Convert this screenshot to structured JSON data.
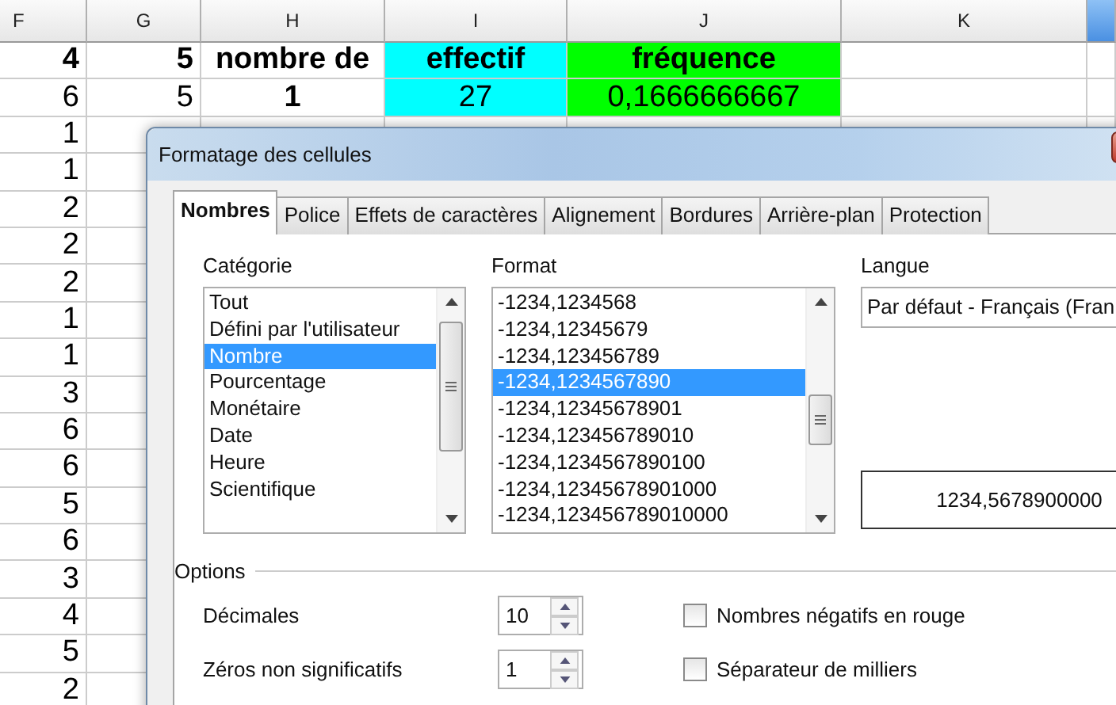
{
  "sheet": {
    "columns": [
      {
        "label": "F"
      },
      {
        "label": "G"
      },
      {
        "label": "H"
      },
      {
        "label": "I"
      },
      {
        "label": "J"
      },
      {
        "label": "K"
      }
    ],
    "rows": [
      {
        "cells": [
          "4",
          "5",
          "nombre de",
          "effectif",
          "fréquence"
        ]
      },
      {
        "cells": [
          "6",
          "5",
          "1",
          "27",
          "0,1666666667"
        ]
      },
      {
        "cells": [
          "1"
        ]
      },
      {
        "cells": [
          "1"
        ]
      },
      {
        "cells": [
          "2"
        ]
      },
      {
        "cells": [
          "2"
        ]
      },
      {
        "cells": [
          "2"
        ]
      },
      {
        "cells": [
          "1"
        ]
      },
      {
        "cells": [
          "1"
        ]
      },
      {
        "cells": [
          "3"
        ]
      },
      {
        "cells": [
          "6"
        ]
      },
      {
        "cells": [
          "6"
        ]
      },
      {
        "cells": [
          "5"
        ]
      },
      {
        "cells": [
          "6"
        ]
      },
      {
        "cells": [
          "3"
        ]
      },
      {
        "cells": [
          "4"
        ]
      },
      {
        "cells": [
          "5"
        ]
      },
      {
        "cells": [
          "2"
        ]
      }
    ]
  },
  "dialog": {
    "title": "Formatage des cellules",
    "tabs": [
      {
        "label": "Nombres",
        "selected": true
      },
      {
        "label": "Police",
        "selected": false
      },
      {
        "label": "Effets de caractères",
        "selected": false
      },
      {
        "label": "Alignement",
        "selected": false
      },
      {
        "label": "Bordures",
        "selected": false
      },
      {
        "label": "Arrière-plan",
        "selected": false
      },
      {
        "label": "Protection",
        "selected": false
      }
    ],
    "category": {
      "label": "Catégorie",
      "items": [
        {
          "label": "Tout",
          "selected": false
        },
        {
          "label": "Défini par l'utilisateur",
          "selected": false
        },
        {
          "label": "Nombre",
          "selected": true
        },
        {
          "label": "Pourcentage",
          "selected": false
        },
        {
          "label": "Monétaire",
          "selected": false
        },
        {
          "label": "Date",
          "selected": false
        },
        {
          "label": "Heure",
          "selected": false
        },
        {
          "label": "Scientifique",
          "selected": false
        }
      ]
    },
    "format": {
      "label": "Format",
      "items": [
        {
          "label": "-1234,1234568",
          "selected": false
        },
        {
          "label": "-1234,12345679",
          "selected": false
        },
        {
          "label": "-1234,123456789",
          "selected": false
        },
        {
          "label": "-1234,1234567890",
          "selected": true
        },
        {
          "label": "-1234,12345678901",
          "selected": false
        },
        {
          "label": "-1234,123456789010",
          "selected": false
        },
        {
          "label": "-1234,1234567890100",
          "selected": false
        },
        {
          "label": "-1234,12345678901000",
          "selected": false
        },
        {
          "label": "-1234,123456789010000",
          "selected": false
        }
      ]
    },
    "language": {
      "label": "Langue",
      "value": "Par défaut - Français (Fran"
    },
    "preview": "1234,5678900000",
    "options": {
      "title": "Options",
      "spins": [
        {
          "label": "Décimales",
          "value": "10"
        },
        {
          "label": "Zéros non significatifs",
          "value": "1"
        }
      ],
      "checks": [
        {
          "label": "Nombres négatifs en rouge",
          "checked": false
        },
        {
          "label": "Séparateur de milliers",
          "checked": false
        }
      ]
    }
  }
}
